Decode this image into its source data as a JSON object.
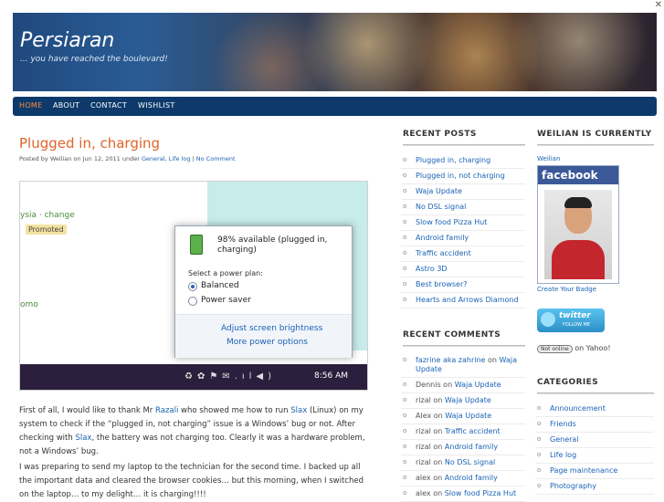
{
  "site": {
    "title": "Persiaran",
    "tagline": "... you have reached the boulevard!"
  },
  "nav": [
    "HOME",
    "ABOUT",
    "CONTACT",
    "WISHLIST"
  ],
  "post": {
    "title": "Plugged in, charging",
    "meta_prefix": "Posted by Weilian on Jun 12, 2011 under",
    "cat1": "General",
    "cat2": "Life log",
    "comments": "No Comment",
    "screenshot": {
      "side_line1": "ysia · change",
      "promoted": "Promoted",
      "side_line2": "omo",
      "battery_status": "98% available (plugged in, charging)",
      "select_plan": "Select a power plan:",
      "plan1": "Balanced",
      "plan2": "Power saver",
      "link1": "Adjust screen brightness",
      "link2": "More power options",
      "clock": "8:56 AM"
    },
    "p1": {
      "a": "First of all, I would like to thank Mr ",
      "razali": "Razali",
      "b": " who showed me how to run ",
      "slax1": "Slax",
      "c": " (Linux) on my system to check if the “plugged in, not charging” issue is a Windows’ bug or not. After checking with ",
      "slax2": "Slax",
      "d": ", the battery was not charging too. Clearly it was a hardware problem, not a Windows’ bug."
    },
    "p2": "I was preparing to send my laptop to the technician for the second time. I backed up all the important data and cleared the browser cookies… but this morning, when I switched on the laptop… to my delight… it is charging!!!!"
  },
  "recent_posts": {
    "heading": "RECENT POSTS",
    "items": [
      "Plugged in, charging",
      "Plugged in, not charging",
      "Waja Update",
      "No DSL signal",
      "Slow food Pizza Hut",
      "Android family",
      "Traffic accident",
      "Astro 3D",
      "Best browser?",
      "Hearts and Arrows Diamond"
    ]
  },
  "recent_comments": {
    "heading": "RECENT COMMENTS",
    "items": [
      {
        "who": "fazrine aka zahrine",
        "post": "Waja Update"
      },
      {
        "who": "Dennis",
        "post": "Waja Update"
      },
      {
        "who": "rizal",
        "post": "Waja Update"
      },
      {
        "who": "Alex",
        "post": "Waja Update"
      },
      {
        "who": "rizal",
        "post": "Traffic accident"
      },
      {
        "who": "rizal",
        "post": "Android family"
      },
      {
        "who": "rizal",
        "post": "No DSL signal"
      },
      {
        "who": "alex",
        "post": "Android family"
      },
      {
        "who": "alex",
        "post": "Slow food Pizza Hut"
      }
    ],
    "connector": "on"
  },
  "currently": {
    "heading": "WEILIAN IS CURRENTLY",
    "user": "Weilian",
    "fb_logo": "facebook",
    "badge_link": "Create Your Badge",
    "twitter_text": "twitter",
    "twitter_sub": "FOLLOW ME",
    "yahoo_status": "Not online",
    "yahoo_label": "on Yahoo!"
  },
  "categories": {
    "heading": "CATEGORIES",
    "items": [
      "Announcement",
      "Friends",
      "General",
      "Life log",
      "Page maintenance",
      "Photography"
    ]
  },
  "colors": {
    "accent": "#e0632a",
    "nav_bg": "#0d3a6b",
    "link": "#1b63b5"
  }
}
